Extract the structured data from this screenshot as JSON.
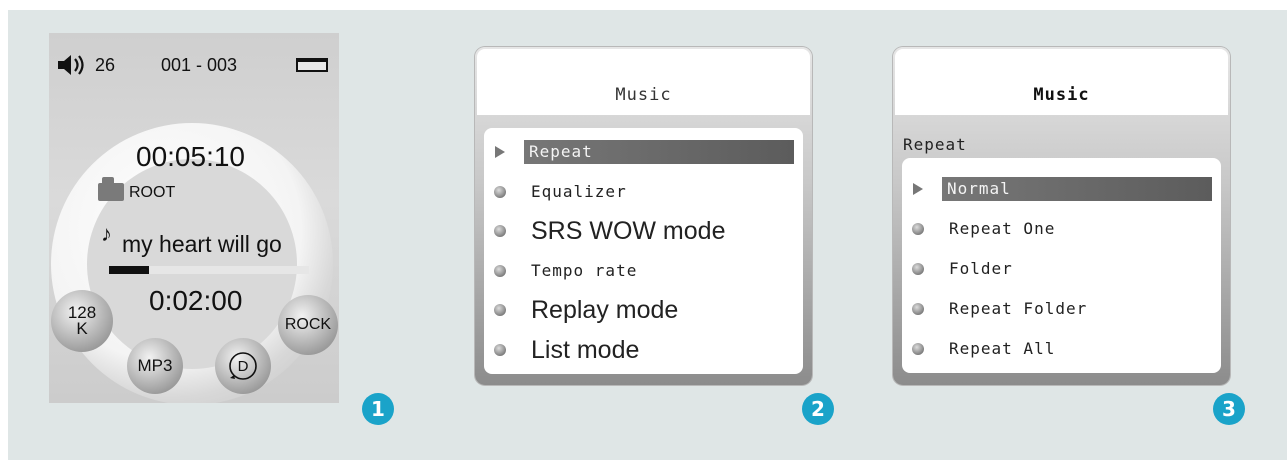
{
  "screen1": {
    "volume": "26",
    "track_counter": "001 - 003",
    "elapsed_time": "00:05:10",
    "folder": "ROOT",
    "song": "my heart will go",
    "progress": 0.2,
    "total_time": "0:02:00",
    "bitrate_top": "128",
    "bitrate_bottom": "K",
    "format": "MP3",
    "equalizer": "ROCK",
    "d_button": "D",
    "icons": [
      "speaker-icon",
      "battery-icon",
      "folder-icon",
      "music-note-icon",
      "loop-icon"
    ]
  },
  "screen2": {
    "title": "Music",
    "items": [
      {
        "label": "Repeat",
        "style": "mono",
        "selected": true
      },
      {
        "label": "Equalizer",
        "style": "mono",
        "selected": false
      },
      {
        "label": "SRS WOW mode",
        "style": "sans",
        "selected": false
      },
      {
        "label": "Tempo rate",
        "style": "mono",
        "selected": false
      },
      {
        "label": "Replay mode",
        "style": "sans",
        "selected": false
      },
      {
        "label": "List mode",
        "style": "sans",
        "selected": false
      }
    ]
  },
  "screen3": {
    "title": "Music",
    "subtitle": "Repeat",
    "items": [
      {
        "label": "Normal",
        "selected": true
      },
      {
        "label": "Repeat One",
        "selected": false
      },
      {
        "label": "Folder",
        "selected": false
      },
      {
        "label": "Repeat Folder",
        "selected": false
      },
      {
        "label": "Repeat All",
        "selected": false
      }
    ]
  },
  "badges": [
    "1",
    "2",
    "3"
  ],
  "colors": {
    "badge": "#1aa3c9",
    "background": "#dfe6e6",
    "selection": "#666666"
  }
}
